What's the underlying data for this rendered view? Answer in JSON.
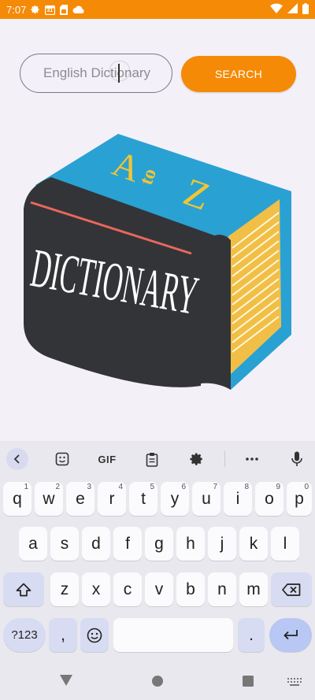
{
  "status_bar": {
    "time": "7:07",
    "calendar_day": "31",
    "icons": [
      "gear-icon",
      "calendar-icon",
      "sim-card-icon",
      "cloud-icon",
      "wifi-icon",
      "signal-icon",
      "battery-icon"
    ],
    "color": "#f58a07"
  },
  "search": {
    "placeholder": "English Dictionary",
    "button_label": "SEARCH"
  },
  "illustration": {
    "title": "DICTIONARY",
    "letter_a": "A",
    "letter_to": "to",
    "letter_z": "Z"
  },
  "keyboard": {
    "toolbar": {
      "gif_label": "GIF",
      "icons": [
        "back-arrow-icon",
        "sticker-icon",
        "gif-icon",
        "clipboard-icon",
        "settings-icon",
        "more-icon",
        "microphone-icon"
      ]
    },
    "row1": [
      {
        "key": "q",
        "hint": "1"
      },
      {
        "key": "w",
        "hint": "2"
      },
      {
        "key": "e",
        "hint": "3"
      },
      {
        "key": "r",
        "hint": "4"
      },
      {
        "key": "t",
        "hint": "5"
      },
      {
        "key": "y",
        "hint": "6"
      },
      {
        "key": "u",
        "hint": "7"
      },
      {
        "key": "i",
        "hint": "8"
      },
      {
        "key": "o",
        "hint": "9"
      },
      {
        "key": "p",
        "hint": "0"
      }
    ],
    "row2": [
      "a",
      "s",
      "d",
      "f",
      "g",
      "h",
      "j",
      "k",
      "l"
    ],
    "row3": [
      "z",
      "x",
      "c",
      "v",
      "b",
      "n",
      "m"
    ],
    "symbols_label": "?123",
    "comma_label": ",",
    "period_label": "."
  },
  "nav_bar": {
    "icons": [
      "back-triangle-icon",
      "home-circle-icon",
      "recents-square-icon",
      "keyboard-switch-icon"
    ]
  }
}
